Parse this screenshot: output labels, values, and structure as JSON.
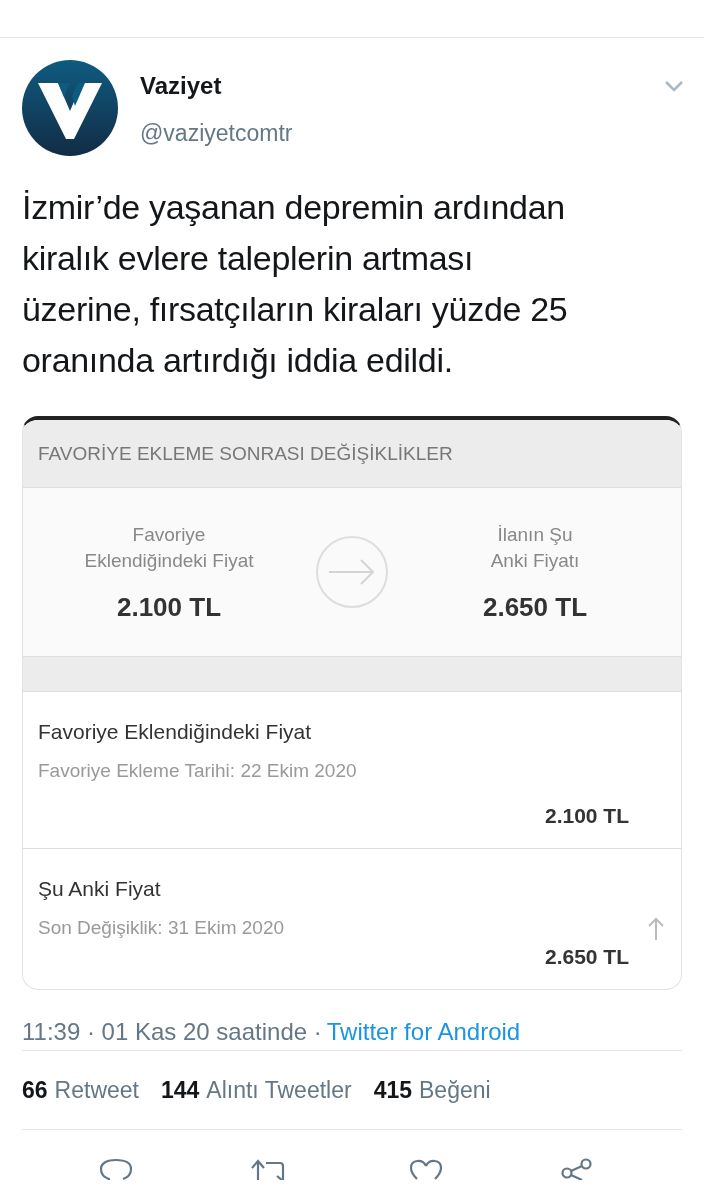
{
  "tweet": {
    "author": {
      "name": "Vaziyet",
      "handle": "@vaziyetcomtr"
    },
    "text": "İzmir’de yaşanan depremin ardından\nkiralık evlere taleplerin artması\nüzerine, fırsatçıların kiraları yüzde 25\noranında artırdığı iddia edildi.",
    "attachment": {
      "header": "FAVORİYE EKLEME SONRASI DEĞİŞİKLİKLER",
      "summary": [
        {
          "label": "Favoriye\nEklendiğindeki Fiyat",
          "price": "2.100 TL"
        },
        {
          "label": "İlanın Şu\nAnki Fiyatı",
          "price": "2.650 TL"
        }
      ],
      "rows": [
        {
          "title": "Favoriye Eklendiğindeki Fiyat",
          "subtitle": "Favoriye Ekleme Tarihi: 22 Ekim 2020",
          "price": "2.100 TL",
          "rising": false
        },
        {
          "title": "Şu Anki Fiyat",
          "subtitle": "Son Değişiklik: 31 Ekim 2020",
          "price": "2.650 TL",
          "rising": true
        }
      ]
    },
    "meta": {
      "time": "11:39 · 01 Kas 20 saatinde ·",
      "source": "Twitter for Android"
    },
    "stats": [
      {
        "count": "66",
        "label": "Retweet"
      },
      {
        "count": "144",
        "label": "Alıntı Tweetler"
      },
      {
        "count": "415",
        "label": "Beğeni"
      }
    ]
  }
}
